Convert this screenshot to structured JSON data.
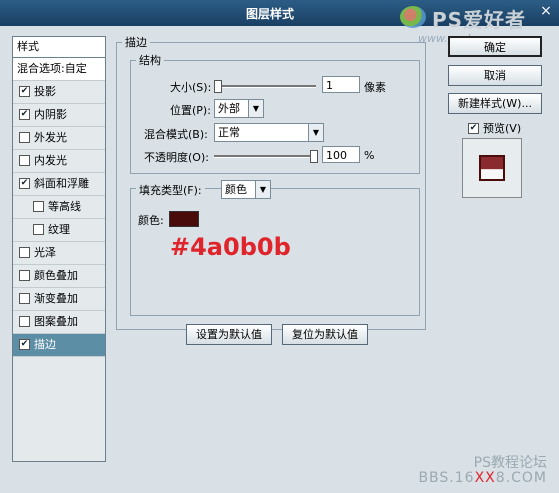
{
  "window": {
    "title": "图层样式",
    "close_glyph": "×"
  },
  "watermark": {
    "logo_text": "PS爱好者",
    "logo_sub": "www.psahz.com",
    "bottom_line1": "PS教程论坛",
    "bottom_line2_pre": "BBS.16",
    "bottom_line2_red": "XX",
    "bottom_line2_post": "8.COM"
  },
  "stylelist": {
    "header": "样式",
    "blend_options": "混合选项:自定",
    "items": [
      {
        "label": "投影",
        "checked": true
      },
      {
        "label": "内阴影",
        "checked": true
      },
      {
        "label": "外发光",
        "checked": false
      },
      {
        "label": "内发光",
        "checked": false
      },
      {
        "label": "斜面和浮雕",
        "checked": true
      },
      {
        "label": "等高线",
        "checked": false,
        "sub": true
      },
      {
        "label": "纹理",
        "checked": false,
        "sub": true
      },
      {
        "label": "光泽",
        "checked": false
      },
      {
        "label": "颜色叠加",
        "checked": false
      },
      {
        "label": "渐变叠加",
        "checked": false
      },
      {
        "label": "图案叠加",
        "checked": false
      },
      {
        "label": "描边",
        "checked": true,
        "selected": true
      }
    ]
  },
  "stroke": {
    "section_title": "描边",
    "structure_title": "结构",
    "size_label": "大小(S):",
    "size_value": "1",
    "size_unit": "像素",
    "size_level": 0,
    "position_label": "位置(P):",
    "position_value": "外部",
    "blend_label": "混合模式(B):",
    "blend_value": "正常",
    "opacity_label": "不透明度(O):",
    "opacity_value": "100",
    "opacity_unit": "%",
    "opacity_level": 1.0,
    "fill_type_label": "填充类型(F):",
    "fill_type_value": "颜色",
    "color_label": "颜色:",
    "color_hex": "#4a0b0b",
    "color_annotation": "#4a0b0b"
  },
  "buttons": {
    "ok": "确定",
    "cancel": "取消",
    "new_style": "新建样式(W)...",
    "preview_label": "预览(V)",
    "preview_checked": true,
    "set_default": "设置为默认值",
    "reset_default": "复位为默认值"
  },
  "check_glyph": "✔"
}
